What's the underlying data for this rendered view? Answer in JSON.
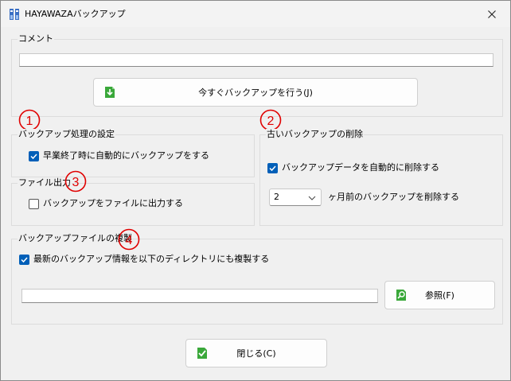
{
  "window": {
    "title": "HAYAWAZAバックアップ"
  },
  "comment_group": {
    "label": "コメント",
    "value": ""
  },
  "backup_now_button": {
    "label": "今すぐバックアップを行う(J)"
  },
  "markers": [
    "1",
    "2",
    "3",
    "4"
  ],
  "backup_settings": {
    "label": "バックアップ処理の設定",
    "auto_backup_on_exit": {
      "label": "早業終了時に自動的にバックアップをする",
      "checked": true
    }
  },
  "file_output": {
    "label": "ファイル出力",
    "output_to_file": {
      "label": "バックアップをファイルに出力する",
      "checked": false
    }
  },
  "old_backup_delete": {
    "label": "古いバックアップの削除",
    "auto_delete": {
      "label": "バックアップデータを自動的に削除する",
      "checked": true
    },
    "months_select": {
      "value": "2"
    },
    "months_suffix": "ヶ月前のバックアップを削除する"
  },
  "backup_file_copy": {
    "label": "バックアップファイルの複製",
    "copy_latest": {
      "label": "最新のバックアップ情報を以下のディレクトリにも複製する",
      "checked": true
    },
    "directory_value": "",
    "browse_label": "参照(F)"
  },
  "close_button": {
    "label": "閉じる(C)"
  },
  "colors": {
    "accent": "#005fb8",
    "marker_red": "#e00000",
    "green_icon": "#2e9e2e"
  }
}
